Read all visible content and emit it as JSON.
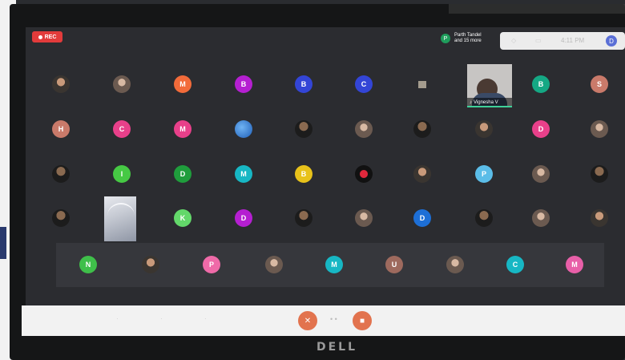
{
  "rec": {
    "label": "REC"
  },
  "participants": {
    "avatar_letter": "P",
    "line1": "Parth Tandel",
    "line2": "and 15 more"
  },
  "topbar": {
    "time": "4:11 PM",
    "user_letter": "D"
  },
  "video_tile": {
    "name": "Vignesha V"
  },
  "brand": "DELL",
  "rows": [
    [
      {
        "kind": "photo"
      },
      {
        "kind": "photo2"
      },
      {
        "letter": "M",
        "color": "#f26b3a"
      },
      {
        "letter": "B",
        "color": "#b51fd1"
      },
      {
        "letter": "B",
        "color": "#3345d6"
      },
      {
        "letter": "C",
        "color": "#3345d6"
      },
      {
        "kind": "smallimg"
      },
      {
        "kind": "video"
      },
      {
        "letter": "B",
        "color": "#15a884"
      },
      {
        "letter": "S",
        "color": "#c97a6a"
      }
    ],
    [
      {
        "letter": "H",
        "color": "#c97a6a"
      },
      {
        "letter": "C",
        "color": "#e8408a"
      },
      {
        "letter": "M",
        "color": "#e8408a"
      },
      {
        "kind": "blue"
      },
      {
        "kind": "photo3"
      },
      {
        "kind": "photo2"
      },
      {
        "kind": "photo3"
      },
      {
        "kind": "photo"
      },
      {
        "letter": "D",
        "color": "#e8408a"
      },
      {
        "kind": "photo2"
      }
    ],
    [
      {
        "kind": "photo3"
      },
      {
        "letter": "I",
        "color": "#46c944"
      },
      {
        "letter": "D",
        "color": "#1f9d3c"
      },
      {
        "letter": "M",
        "color": "#17b7c4"
      },
      {
        "letter": "B",
        "color": "#e8c21a"
      },
      {
        "kind": "red"
      },
      {
        "kind": "photo"
      },
      {
        "letter": "P",
        "color": "#5bbde8"
      },
      {
        "kind": "photo2"
      },
      {
        "kind": "photo3"
      }
    ],
    [
      {
        "kind": "photo3"
      },
      {
        "kind": "rect"
      },
      {
        "letter": "K",
        "color": "#63d86a"
      },
      {
        "letter": "D",
        "color": "#b51fd1"
      },
      {
        "kind": "photo3"
      },
      {
        "kind": "photo2"
      },
      {
        "letter": "D",
        "color": "#1d6fd6"
      },
      {
        "kind": "photo3"
      },
      {
        "kind": "photo2"
      },
      {
        "kind": "photo"
      }
    ]
  ],
  "bottom_row": [
    {
      "letter": "N",
      "color": "#3fbf4a"
    },
    {
      "kind": "photo"
    },
    {
      "letter": "P",
      "color": "#ef6aa8"
    },
    {
      "kind": "photo2"
    },
    {
      "letter": "M",
      "color": "#17b7c4"
    },
    {
      "letter": "U",
      "color": "#9e6a5e"
    },
    {
      "kind": "photo2"
    },
    {
      "letter": "C",
      "color": "#17b7c4"
    },
    {
      "letter": "M",
      "color": "#e85fa8"
    }
  ]
}
